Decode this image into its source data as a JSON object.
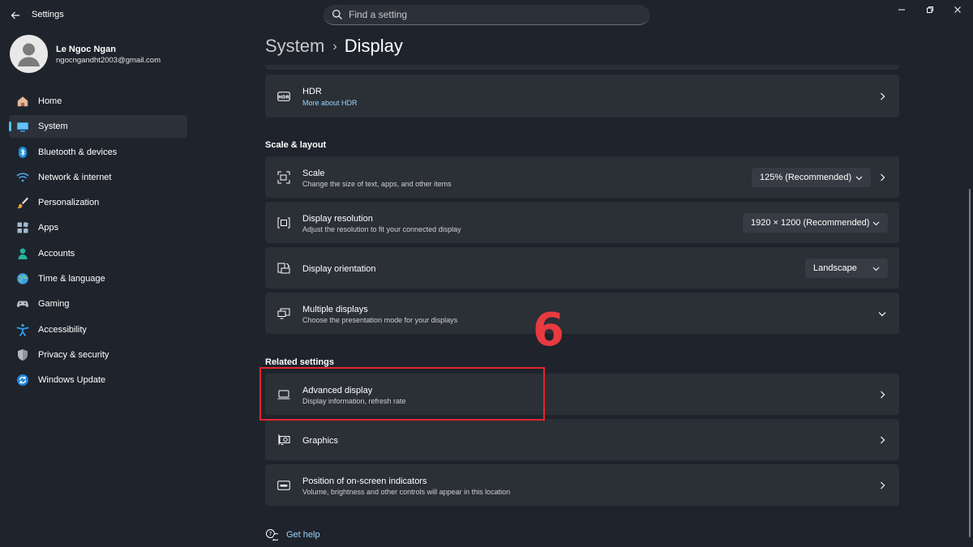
{
  "app": {
    "title": "Settings"
  },
  "search": {
    "placeholder": "Find a setting"
  },
  "user": {
    "name": "Le Ngoc Ngan",
    "email": "ngocngandht2003@gmail.com"
  },
  "sidebar": {
    "active_item": "System",
    "items": [
      {
        "label": "Home",
        "icon": "home-icon"
      },
      {
        "label": "System",
        "icon": "system-icon"
      },
      {
        "label": "Bluetooth & devices",
        "icon": "bluetooth-icon"
      },
      {
        "label": "Network & internet",
        "icon": "network-icon"
      },
      {
        "label": "Personalization",
        "icon": "brush-icon"
      },
      {
        "label": "Apps",
        "icon": "apps-icon"
      },
      {
        "label": "Accounts",
        "icon": "accounts-icon"
      },
      {
        "label": "Time & language",
        "icon": "globe-icon"
      },
      {
        "label": "Gaming",
        "icon": "gamepad-icon"
      },
      {
        "label": "Accessibility",
        "icon": "accessibility-icon"
      },
      {
        "label": "Privacy & security",
        "icon": "shield-icon"
      },
      {
        "label": "Windows Update",
        "icon": "update-icon"
      }
    ]
  },
  "breadcrumb": {
    "parent": "System",
    "separator": "›",
    "current": "Display"
  },
  "hdr": {
    "title": "HDR",
    "link": "More about HDR"
  },
  "scale_layout": {
    "heading": "Scale & layout",
    "scale": {
      "title": "Scale",
      "subtitle": "Change the size of text, apps, and other items",
      "value": "125% (Recommended)"
    },
    "resolution": {
      "title": "Display resolution",
      "subtitle": "Adjust the resolution to fit your connected display",
      "value": "1920 × 1200 (Recommended)"
    },
    "orientation": {
      "title": "Display orientation",
      "value": "Landscape"
    },
    "multiple": {
      "title": "Multiple displays",
      "subtitle": "Choose the presentation mode for your displays"
    }
  },
  "related": {
    "heading": "Related settings",
    "advanced": {
      "title": "Advanced display",
      "subtitle": "Display information, refresh rate"
    },
    "graphics": {
      "title": "Graphics"
    },
    "indicators": {
      "title": "Position of on-screen indicators",
      "subtitle": "Volume, brightness and other controls will appear in this location"
    }
  },
  "get_help": {
    "label": "Get help"
  },
  "annotation": {
    "step": "6",
    "highlight_color": "#e3262f"
  },
  "colors": {
    "background": "#1f232b",
    "card": "#2b2f36",
    "accent": "#4cc2ff",
    "link": "#99d5ff"
  }
}
